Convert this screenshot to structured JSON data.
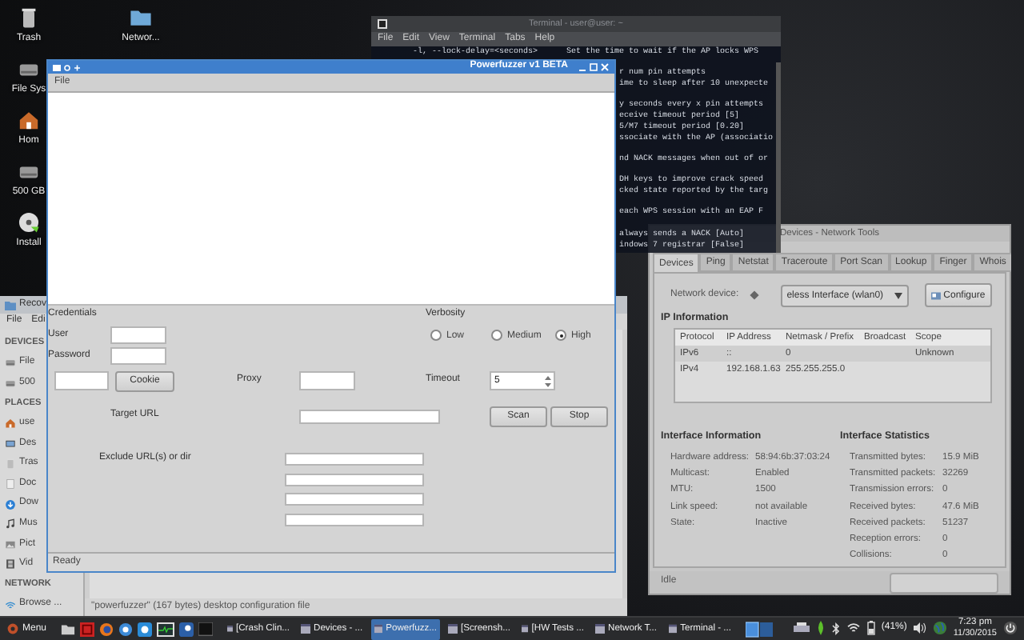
{
  "desktop": {
    "icon_columns": [
      [
        {
          "kind": "trash",
          "label": "Trash"
        },
        {
          "kind": "drive",
          "label": "File Sys"
        },
        {
          "kind": "home",
          "label": "Hom"
        },
        {
          "kind": "drive",
          "label": "500 GB"
        },
        {
          "kind": "disc",
          "label": "Install"
        }
      ],
      [
        {
          "kind": "folder",
          "label": "Networ..."
        }
      ]
    ]
  },
  "file_manager": {
    "title": "Recov",
    "menu": [
      "File",
      "Edi"
    ],
    "sidebar": [
      {
        "heading": "DEVICES",
        "items": [
          {
            "kind": "drive",
            "label": "File"
          },
          {
            "kind": "drive",
            "label": "500"
          }
        ]
      },
      {
        "heading": "PLACES",
        "items": [
          {
            "kind": "home",
            "label": "use"
          },
          {
            "kind": "desktop",
            "label": "Des"
          },
          {
            "kind": "trash",
            "label": "Tras"
          },
          {
            "kind": "document",
            "label": "Doc"
          },
          {
            "kind": "download",
            "label": "Dow"
          },
          {
            "kind": "music",
            "label": "Mus"
          },
          {
            "kind": "picture",
            "label": "Pict"
          },
          {
            "kind": "video",
            "label": "Vid"
          }
        ]
      },
      {
        "heading": "NETWORK",
        "items": [
          {
            "kind": "network",
            "label": "Browse ..."
          }
        ]
      }
    ],
    "status": "\"powerfuzzer\" (167 bytes) desktop configuration file"
  },
  "terminal": {
    "title": "Terminal - user@user: ~",
    "menu": [
      "File",
      "Edit",
      "View",
      "Terminal",
      "Tabs",
      "Help"
    ],
    "lines": [
      {
        "kind": "full",
        "text": "-l, --lock-delay=<seconds>      Set the time to wait if the AP locks WPS"
      },
      {
        "kind": "tail-gap",
        "text": "r num pin attempts"
      },
      {
        "kind": "tail",
        "text": "ime to sleep after 10 unexpecte"
      },
      {
        "kind": "tail-gap",
        "text": "y seconds every x pin attempts"
      },
      {
        "kind": "tail",
        "text": "eceive timeout period [5]"
      },
      {
        "kind": "tail",
        "text": "5/M7 timeout period [0.20]"
      },
      {
        "kind": "tail",
        "text": "ssociate with the AP (associatio"
      },
      {
        "kind": "tail-gap",
        "text": "nd NACK messages when out of or"
      },
      {
        "kind": "tail-gap",
        "text": "DH keys to improve crack speed"
      },
      {
        "kind": "tail",
        "text": "cked state reported by the targ"
      },
      {
        "kind": "tail-gap",
        "text": "each WPS session with an EAP F"
      },
      {
        "kind": "tail-gap",
        "text": "always sends a NACK [Auto]"
      },
      {
        "kind": "tail",
        "text": "indows 7 registrar [False]"
      }
    ]
  },
  "network_tools": {
    "title": "Devices - Network Tools",
    "tabs": [
      {
        "label": "Devices",
        "selected": true
      },
      {
        "label": "Ping",
        "selected": false
      },
      {
        "label": "Netstat",
        "selected": false
      },
      {
        "label": "Traceroute",
        "selected": false
      },
      {
        "label": "Port Scan",
        "selected": false
      },
      {
        "label": "Lookup",
        "selected": false
      },
      {
        "label": "Finger",
        "selected": false
      },
      {
        "label": "Whois",
        "selected": false
      }
    ],
    "device_label": "Network device:",
    "device_value": "eless Interface (wlan0)",
    "configure_button": "Configure",
    "ip_information": {
      "title": "IP Information",
      "columns": [
        "Protocol",
        "IP Address",
        "Netmask / Prefix",
        "Broadcast",
        "Scope"
      ],
      "rows": [
        {
          "protocol": "IPv6",
          "ip_address": "::",
          "netmask": "0",
          "scope": "Unknown"
        },
        {
          "protocol": "IPv4",
          "ip_address": "192.168.1.63",
          "netmask": "255.255.255.0"
        }
      ]
    },
    "interface_information": {
      "title": "Interface Information",
      "rows": [
        {
          "label": "Hardware address:",
          "value": "58:94:6b:37:03:24"
        },
        {
          "label": "Multicast:",
          "value": "Enabled"
        },
        {
          "label": "MTU:",
          "value": "1500"
        },
        {
          "label": "Link speed:",
          "value": "not available"
        },
        {
          "label": "State:",
          "value": "Inactive"
        }
      ]
    },
    "interface_statistics": {
      "title": "Interface Statistics",
      "rows": [
        {
          "label": "Transmitted bytes:",
          "value": "15.9 MiB"
        },
        {
          "label": "Transmitted packets:",
          "value": "32269"
        },
        {
          "label": "Transmission errors:",
          "value": "0"
        },
        {
          "label": "Received bytes:",
          "value": "47.6 MiB"
        },
        {
          "label": "Received packets:",
          "value": "51237"
        },
        {
          "label": "Reception errors:",
          "value": "0"
        },
        {
          "label": "Collisions:",
          "value": "0"
        }
      ]
    },
    "status": "Idle"
  },
  "powerfuzzer": {
    "title": "Powerfuzzer v1 BETA",
    "menu": [
      "File"
    ],
    "credentials_label": "Credentials",
    "user_label": "User",
    "password_label": "Password",
    "cookie_button": "Cookie",
    "proxy_label": "Proxy",
    "verbosity": {
      "label": "Verbosity",
      "options": [
        {
          "label": "Low",
          "selected": false
        },
        {
          "label": "Medium",
          "selected": false
        },
        {
          "label": "High",
          "selected": true
        }
      ]
    },
    "timeout": {
      "label": "Timeout",
      "value": "5"
    },
    "target_url_label": "Target URL",
    "scan_button": "Scan",
    "stop_button": "Stop",
    "exclude_label": "Exclude URL(s) or dir",
    "status": "Ready"
  },
  "taskbar": {
    "menu_label": "Menu",
    "tasks": [
      {
        "label": "[Crash Clin...",
        "selected": false
      },
      {
        "label": "Devices - ...",
        "selected": false
      },
      {
        "label": "Powerfuzz...",
        "selected": true
      },
      {
        "label": "[Screensh...",
        "selected": false
      },
      {
        "label": "[HW Tests ...",
        "selected": false
      },
      {
        "label": "Network T...",
        "selected": false
      },
      {
        "label": "Terminal - ...",
        "selected": false
      }
    ],
    "battery": "(41%)",
    "time": "7:23 pm",
    "date": "11/30/2015"
  }
}
